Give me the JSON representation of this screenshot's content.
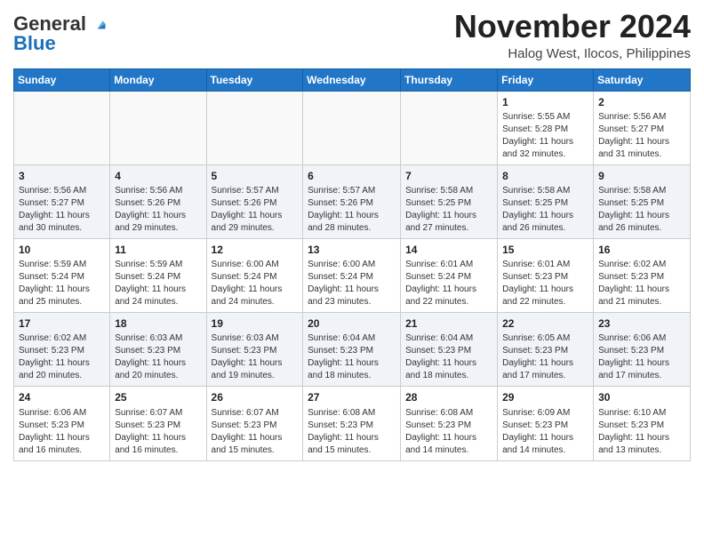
{
  "header": {
    "logo_line1": "General",
    "logo_line2": "Blue",
    "month": "November 2024",
    "location": "Halog West, Ilocos, Philippines"
  },
  "weekdays": [
    "Sunday",
    "Monday",
    "Tuesday",
    "Wednesday",
    "Thursday",
    "Friday",
    "Saturday"
  ],
  "weeks": [
    [
      {
        "day": "",
        "info": ""
      },
      {
        "day": "",
        "info": ""
      },
      {
        "day": "",
        "info": ""
      },
      {
        "day": "",
        "info": ""
      },
      {
        "day": "",
        "info": ""
      },
      {
        "day": "1",
        "info": "Sunrise: 5:55 AM\nSunset: 5:28 PM\nDaylight: 11 hours\nand 32 minutes."
      },
      {
        "day": "2",
        "info": "Sunrise: 5:56 AM\nSunset: 5:27 PM\nDaylight: 11 hours\nand 31 minutes."
      }
    ],
    [
      {
        "day": "3",
        "info": "Sunrise: 5:56 AM\nSunset: 5:27 PM\nDaylight: 11 hours\nand 30 minutes."
      },
      {
        "day": "4",
        "info": "Sunrise: 5:56 AM\nSunset: 5:26 PM\nDaylight: 11 hours\nand 29 minutes."
      },
      {
        "day": "5",
        "info": "Sunrise: 5:57 AM\nSunset: 5:26 PM\nDaylight: 11 hours\nand 29 minutes."
      },
      {
        "day": "6",
        "info": "Sunrise: 5:57 AM\nSunset: 5:26 PM\nDaylight: 11 hours\nand 28 minutes."
      },
      {
        "day": "7",
        "info": "Sunrise: 5:58 AM\nSunset: 5:25 PM\nDaylight: 11 hours\nand 27 minutes."
      },
      {
        "day": "8",
        "info": "Sunrise: 5:58 AM\nSunset: 5:25 PM\nDaylight: 11 hours\nand 26 minutes."
      },
      {
        "day": "9",
        "info": "Sunrise: 5:58 AM\nSunset: 5:25 PM\nDaylight: 11 hours\nand 26 minutes."
      }
    ],
    [
      {
        "day": "10",
        "info": "Sunrise: 5:59 AM\nSunset: 5:24 PM\nDaylight: 11 hours\nand 25 minutes."
      },
      {
        "day": "11",
        "info": "Sunrise: 5:59 AM\nSunset: 5:24 PM\nDaylight: 11 hours\nand 24 minutes."
      },
      {
        "day": "12",
        "info": "Sunrise: 6:00 AM\nSunset: 5:24 PM\nDaylight: 11 hours\nand 24 minutes."
      },
      {
        "day": "13",
        "info": "Sunrise: 6:00 AM\nSunset: 5:24 PM\nDaylight: 11 hours\nand 23 minutes."
      },
      {
        "day": "14",
        "info": "Sunrise: 6:01 AM\nSunset: 5:24 PM\nDaylight: 11 hours\nand 22 minutes."
      },
      {
        "day": "15",
        "info": "Sunrise: 6:01 AM\nSunset: 5:23 PM\nDaylight: 11 hours\nand 22 minutes."
      },
      {
        "day": "16",
        "info": "Sunrise: 6:02 AM\nSunset: 5:23 PM\nDaylight: 11 hours\nand 21 minutes."
      }
    ],
    [
      {
        "day": "17",
        "info": "Sunrise: 6:02 AM\nSunset: 5:23 PM\nDaylight: 11 hours\nand 20 minutes."
      },
      {
        "day": "18",
        "info": "Sunrise: 6:03 AM\nSunset: 5:23 PM\nDaylight: 11 hours\nand 20 minutes."
      },
      {
        "day": "19",
        "info": "Sunrise: 6:03 AM\nSunset: 5:23 PM\nDaylight: 11 hours\nand 19 minutes."
      },
      {
        "day": "20",
        "info": "Sunrise: 6:04 AM\nSunset: 5:23 PM\nDaylight: 11 hours\nand 18 minutes."
      },
      {
        "day": "21",
        "info": "Sunrise: 6:04 AM\nSunset: 5:23 PM\nDaylight: 11 hours\nand 18 minutes."
      },
      {
        "day": "22",
        "info": "Sunrise: 6:05 AM\nSunset: 5:23 PM\nDaylight: 11 hours\nand 17 minutes."
      },
      {
        "day": "23",
        "info": "Sunrise: 6:06 AM\nSunset: 5:23 PM\nDaylight: 11 hours\nand 17 minutes."
      }
    ],
    [
      {
        "day": "24",
        "info": "Sunrise: 6:06 AM\nSunset: 5:23 PM\nDaylight: 11 hours\nand 16 minutes."
      },
      {
        "day": "25",
        "info": "Sunrise: 6:07 AM\nSunset: 5:23 PM\nDaylight: 11 hours\nand 16 minutes."
      },
      {
        "day": "26",
        "info": "Sunrise: 6:07 AM\nSunset: 5:23 PM\nDaylight: 11 hours\nand 15 minutes."
      },
      {
        "day": "27",
        "info": "Sunrise: 6:08 AM\nSunset: 5:23 PM\nDaylight: 11 hours\nand 15 minutes."
      },
      {
        "day": "28",
        "info": "Sunrise: 6:08 AM\nSunset: 5:23 PM\nDaylight: 11 hours\nand 14 minutes."
      },
      {
        "day": "29",
        "info": "Sunrise: 6:09 AM\nSunset: 5:23 PM\nDaylight: 11 hours\nand 14 minutes."
      },
      {
        "day": "30",
        "info": "Sunrise: 6:10 AM\nSunset: 5:23 PM\nDaylight: 11 hours\nand 13 minutes."
      }
    ]
  ]
}
